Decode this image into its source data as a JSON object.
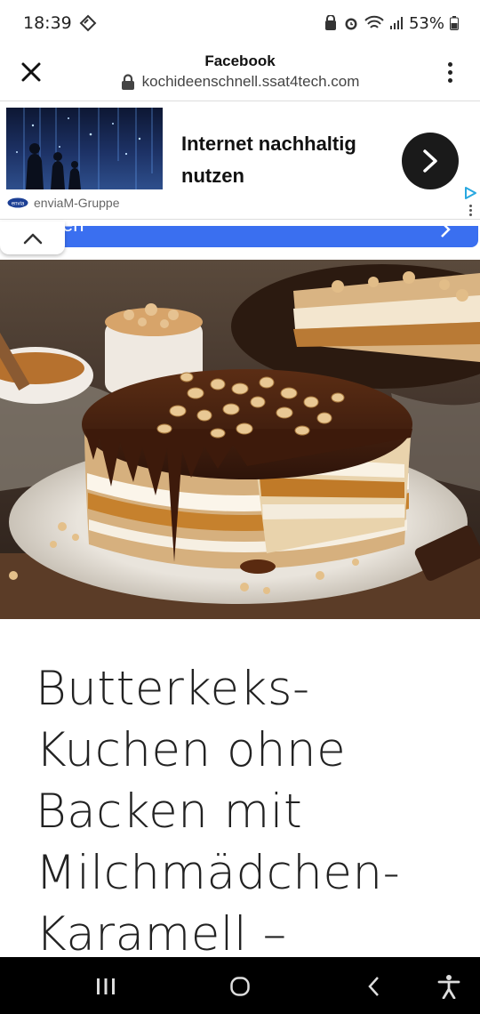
{
  "status_bar": {
    "time": "18:39",
    "battery": "53%"
  },
  "browser": {
    "title": "Facebook",
    "url": "kochideenschnell.ssat4tech.com"
  },
  "ad": {
    "headline": "Internet nachhaltig nutzen",
    "sponsor": "enviaM-Gruppe",
    "logo_text": "envia"
  },
  "blue_button": {
    "label": "en"
  },
  "article": {
    "title": "Butterkeks-Kuchen ohne Backen mit Milchmädchen-Karamell –"
  },
  "colors": {
    "accent_blue": "#3a6ff0",
    "nav_bg": "#000000",
    "cta_bg": "#1a1a1a"
  },
  "icons": [
    "close-icon",
    "lock-icon",
    "more-vert-icon",
    "chevron-right-icon",
    "chevron-up-icon",
    "adchoices-icon",
    "recent-apps-icon",
    "home-icon",
    "back-icon",
    "accessibility-icon"
  ]
}
